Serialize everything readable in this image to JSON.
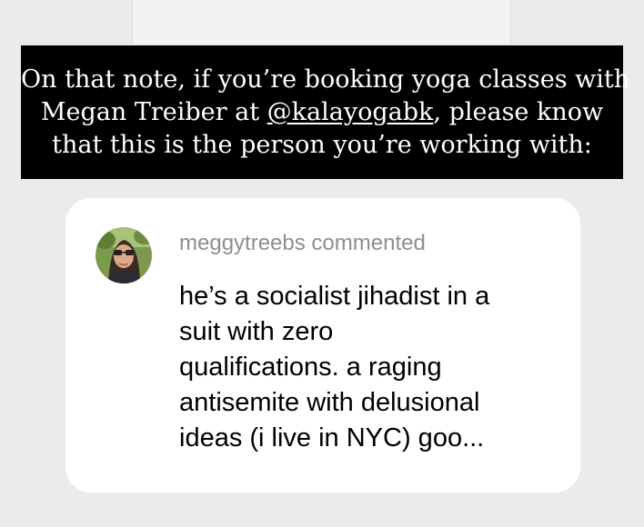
{
  "banner": {
    "line1": "On that note, if you’re booking yoga classes with",
    "line2_prefix": "Megan Treiber at ",
    "line2_mention": "@kalayogabk",
    "line2_suffix": ", please know",
    "line3": "that this is the person you’re working with:"
  },
  "comment": {
    "username": "meggytreebs",
    "action": "commented",
    "lines": [
      "he’s a socialist jihadist in a",
      "suit with zero",
      "qualifications. a raging",
      "antisemite with delusional",
      "ideas (i live in NYC) goo..."
    ]
  }
}
